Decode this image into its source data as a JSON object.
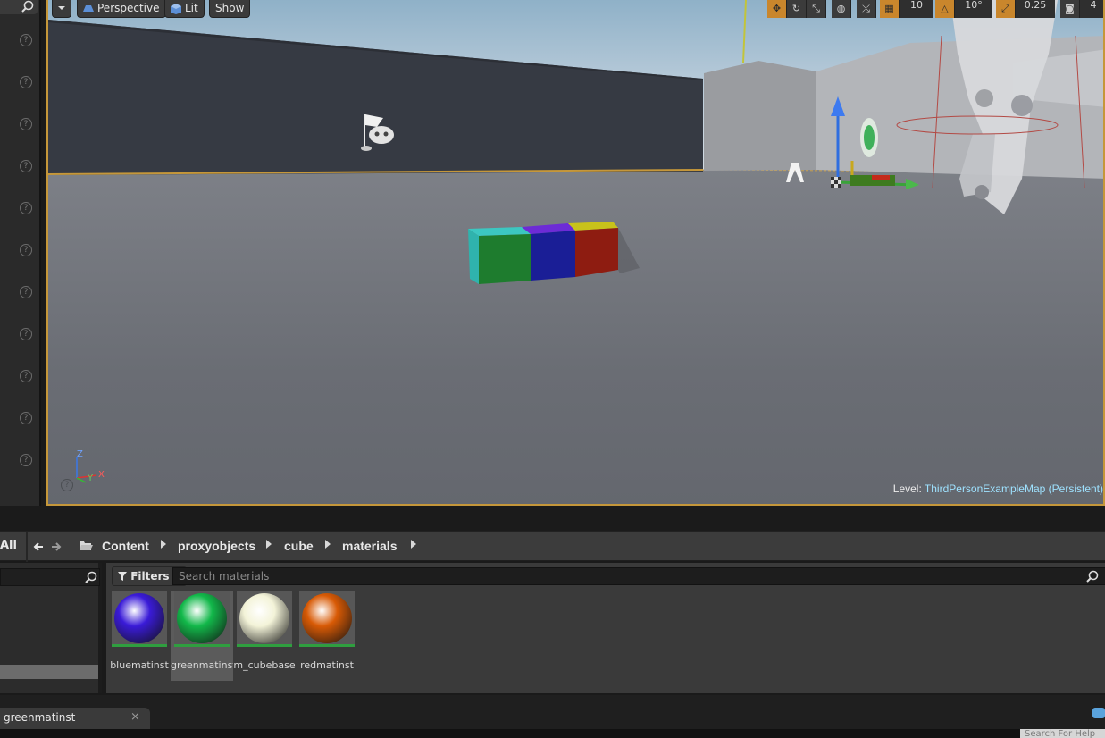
{
  "viewport": {
    "perspective_label": "Perspective",
    "lit_label": "Lit",
    "show_label": "Show",
    "grid_snap_value": "10",
    "rotation_snap_value": "10°",
    "scale_snap_value": "0.25",
    "camera_speed_value": "4",
    "level_prefix": "Level:",
    "level_name": "ThirdPersonExampleMap (Persistent)",
    "axis_z": "Z",
    "axis_y": "Y",
    "axis_x": "X"
  },
  "breadcrumb": {
    "all_label": "All",
    "items": [
      "Content",
      "proxyobjects",
      "cube",
      "materials"
    ]
  },
  "assets": {
    "filters_label": "Filters",
    "search_placeholder": "Search materials",
    "items": [
      {
        "label": "bluematinst",
        "color": "#3a1bd8"
      },
      {
        "label": "greenmatinst",
        "color": "#12b84a"
      },
      {
        "label": "m_cubebase",
        "color": "#f3f3d8"
      },
      {
        "label": "redmatinst",
        "color": "#d85a05"
      }
    ],
    "selected_index": 1
  },
  "tabs": {
    "open_tab_label": "greenmatinst",
    "close_glyph": "×"
  },
  "help_search_placeholder": "Search For Help"
}
